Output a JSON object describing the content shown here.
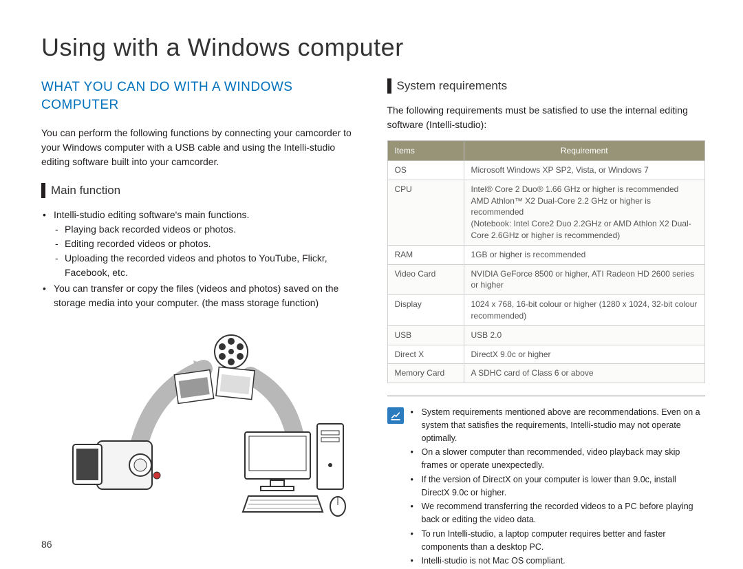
{
  "page_number": "86",
  "title": "Using with a Windows computer",
  "left": {
    "h2": "WHAT YOU CAN DO WITH A WINDOWS COMPUTER",
    "intro": "You can perform the following functions by connecting your camcorder to your Windows computer with a USB cable and using the Intelli-studio editing software built into your camcorder.",
    "section_label": "Main function",
    "bullets": {
      "b1": "Intelli-studio editing software's main functions.",
      "b1a": "Playing back recorded videos or photos.",
      "b1b": "Editing recorded videos or photos.",
      "b1c": "Uploading the recorded videos and photos to YouTube, Flickr, Facebook, etc.",
      "b2": "You can transfer or copy the files (videos and photos) saved on the storage media into your computer. (the mass storage function)"
    }
  },
  "right": {
    "section_label": "System requirements",
    "intro": "The following requirements must be satisfied to use the internal editing software (Intelli-studio):",
    "table": {
      "th1": "Items",
      "th2": "Requirement",
      "rows": [
        {
          "k": "OS",
          "v": "Microsoft Windows XP SP2, Vista, or Windows 7"
        },
        {
          "k": "CPU",
          "v": "Intel® Core 2 Duo® 1.66 GHz or higher is recommended\nAMD Athlon™ X2 Dual-Core 2.2 GHz or higher is recommended\n(Notebook: Intel Core2 Duo 2.2GHz or AMD Athlon X2 Dual-Core 2.6GHz or higher is recommended)"
        },
        {
          "k": "RAM",
          "v": "1GB or higher is recommended"
        },
        {
          "k": "Video Card",
          "v": "NVIDIA GeForce 8500 or higher, ATI Radeon HD 2600 series or higher"
        },
        {
          "k": "Display",
          "v": "1024 x 768, 16-bit colour or higher (1280 x 1024, 32-bit colour recommended)"
        },
        {
          "k": "USB",
          "v": "USB 2.0"
        },
        {
          "k": "Direct X",
          "v": "DirectX 9.0c or higher"
        },
        {
          "k": "Memory Card",
          "v": "A SDHC card of Class 6 or above"
        }
      ]
    },
    "notes": [
      "System requirements mentioned above are recommendations. Even on a system that satisfies the requirements, Intelli-studio may not operate optimally.",
      "On a slower computer than recommended, video playback may skip frames or operate unexpectedly.",
      "If the version of DirectX on your computer is lower than 9.0c, install DirectX 9.0c or higher.",
      "We recommend transferring the recorded videos to a PC before playing back or editing the video data.",
      "To run Intelli-studio, a laptop computer requires better and faster components than a desktop PC.",
      "Intelli-studio is not Mac OS compliant."
    ]
  }
}
